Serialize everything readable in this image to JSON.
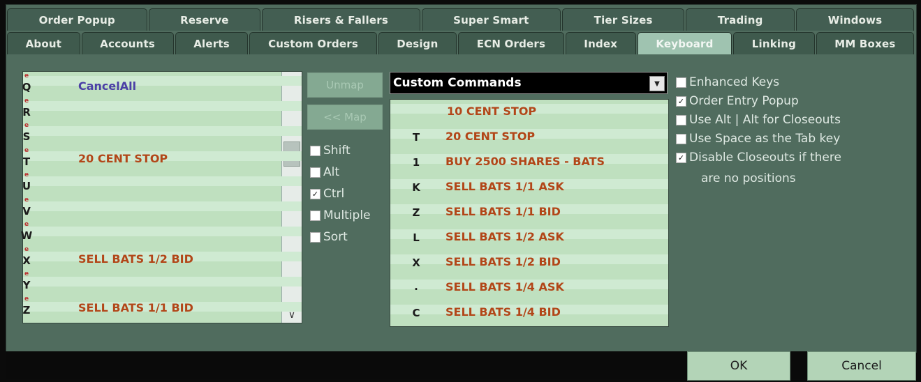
{
  "tabs_row1": [
    "Order Popup",
    "Reserve",
    "Risers & Fallers",
    "Super Smart",
    "Tier Sizes",
    "Trading",
    "Windows"
  ],
  "tabs_row2": [
    "About",
    "Accounts",
    "Alerts",
    "Custom Orders",
    "Design",
    "ECN Orders",
    "Index",
    "Keyboard",
    "Linking",
    "MM Boxes"
  ],
  "active_tab": "Keyboard",
  "left_list": {
    "keys": [
      "Q",
      "R",
      "S",
      "T",
      "U",
      "V",
      "W",
      "X",
      "Y",
      "Z"
    ],
    "key_marker": "e",
    "items": [
      {
        "label": "CancelAll",
        "color": "blue"
      },
      {
        "label": "20 CENT STOP",
        "color": "red"
      },
      {
        "label": "SELL BATS 1/2 BID",
        "color": "red"
      },
      {
        "label": "SELL BATS 1/1 BID",
        "color": "red"
      }
    ]
  },
  "buttons": {
    "unmap": "Unmap",
    "map": "<< Map"
  },
  "modifiers": [
    {
      "label": "Shift",
      "checked": false
    },
    {
      "label": "Alt",
      "checked": false
    },
    {
      "label": "Ctrl",
      "checked": true
    },
    {
      "label": "Multiple",
      "checked": false
    },
    {
      "label": "Sort",
      "checked": false
    }
  ],
  "dropdown": {
    "selected": "Custom Commands"
  },
  "right_list": {
    "keys": [
      "T",
      "1",
      "K",
      "Z",
      "L",
      "X",
      ".",
      "C"
    ],
    "items": [
      "10 CENT STOP",
      "20 CENT STOP",
      "BUY 2500 SHARES - BATS",
      "SELL BATS 1/1 ASK",
      "SELL BATS 1/1 BID",
      "SELL BATS 1/2 ASK",
      "SELL BATS 1/2 BID",
      "SELL BATS 1/4 ASK",
      "SELL BATS 1/4 BID"
    ]
  },
  "options": [
    {
      "label": "Enhanced Keys",
      "checked": false
    },
    {
      "label": "Order Entry Popup",
      "checked": true
    },
    {
      "label": "Use Alt | Alt for Closeouts",
      "checked": false
    },
    {
      "label": "Use Space as the Tab key",
      "checked": false
    },
    {
      "label": "Disable Closeouts if there",
      "checked": true
    }
  ],
  "options_continuation": "are no positions",
  "footer": {
    "ok": "OK",
    "cancel": "Cancel"
  }
}
